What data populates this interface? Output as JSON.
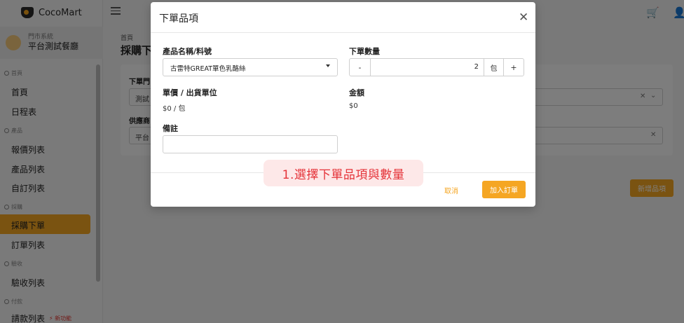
{
  "app": {
    "brand_name": "CocoMart",
    "store_system": "門市系統",
    "store_name": "平台測試餐廳"
  },
  "sidebar": {
    "sections": [
      {
        "label": "首頁",
        "items": [
          "首頁",
          "日程表"
        ]
      },
      {
        "label": "產品",
        "items": [
          "報價列表",
          "產品列表",
          "自訂列表"
        ]
      },
      {
        "label": "採購",
        "items": [
          "採購下單",
          "訂單列表"
        ]
      },
      {
        "label": "驗收",
        "items": [
          "驗收列表"
        ]
      },
      {
        "label": "付款",
        "items": [
          "請款列表"
        ]
      }
    ],
    "active_item": "採購下單",
    "new_badge": "新功能"
  },
  "page": {
    "breadcrumb": "首頁",
    "title": "採購下",
    "field1_label": "下單門",
    "field1_value": "測試",
    "field2_label": "供應商",
    "field2_value": "平台",
    "add_item_label": "新增品項"
  },
  "modal": {
    "title": "下單品項",
    "product_label": "產品名稱/料號",
    "product_value": "古雷特GREAT單色乳酪絲",
    "qty_label": "下單數量",
    "qty_minus": "-",
    "qty_value": "2",
    "qty_unit": "包",
    "qty_plus": "+",
    "unit_price_label": "單價 / 出貨單位",
    "unit_price_value": "$0 / 包",
    "amount_label": "金額",
    "amount_value": "$0",
    "remark_label": "備註",
    "remark_value": "",
    "cancel_label": "取消",
    "submit_label": "加入訂單"
  },
  "callout": {
    "text": "1.選擇下單品項與數量"
  },
  "colors": {
    "accent": "#f5a623",
    "callout_text": "#e5343a",
    "callout_bg": "#fde8e8"
  },
  "icons": {
    "close": "close-icon",
    "cart": "cart-icon",
    "user": "user-icon",
    "menu": "menu-toggle-icon"
  }
}
